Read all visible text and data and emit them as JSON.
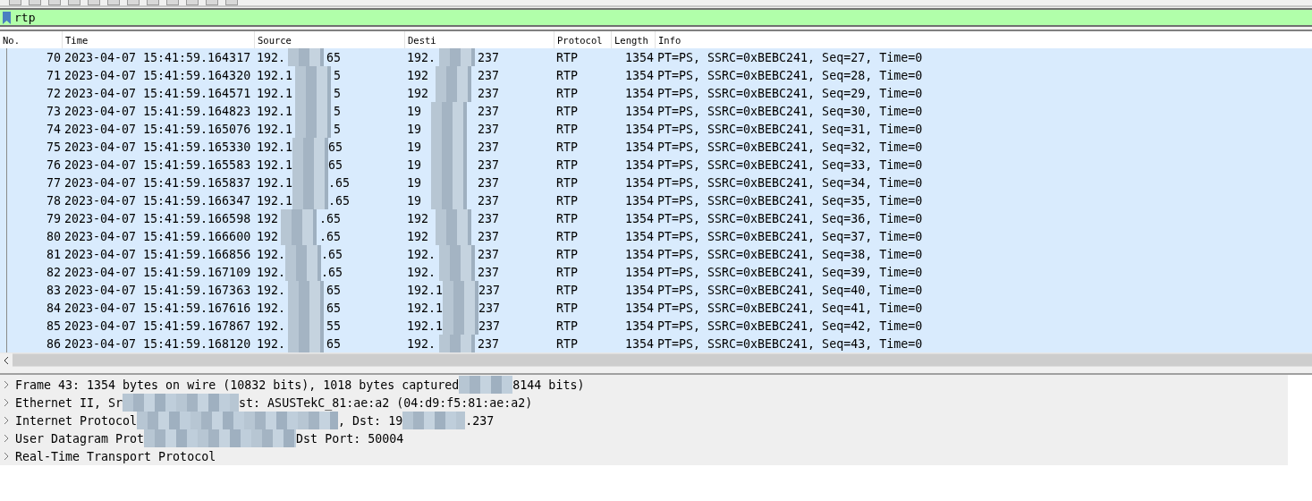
{
  "filter": {
    "value": "rtp"
  },
  "columns": [
    "No.",
    "Time",
    "Source",
    "Desti",
    "Protocol",
    "Length",
    "Info"
  ],
  "rows": [
    {
      "no": "70",
      "time": "2023-04-07 15:41:59.164317",
      "source": [
        "192.",
        "65"
      ],
      "destination": [
        "192.",
        "237"
      ],
      "protocol": "RTP",
      "length": "1354",
      "info": "PT=PS, SSRC=0xBEBC241, Seq=27, Time=0",
      "selected": true
    },
    {
      "no": "71",
      "time": "2023-04-07 15:41:59.164320",
      "source": [
        "192.1",
        "5"
      ],
      "destination": [
        "192",
        "237"
      ],
      "protocol": "RTP",
      "length": "1354",
      "info": "PT=PS, SSRC=0xBEBC241, Seq=28, Time=0",
      "selected": true
    },
    {
      "no": "72",
      "time": "2023-04-07 15:41:59.164571",
      "source": [
        "192.1",
        "5"
      ],
      "destination": [
        "192",
        "237"
      ],
      "protocol": "RTP",
      "length": "1354",
      "info": "PT=PS, SSRC=0xBEBC241, Seq=29, Time=0",
      "selected": true
    },
    {
      "no": "73",
      "time": "2023-04-07 15:41:59.164823",
      "source": [
        "192.1",
        "5"
      ],
      "destination": [
        "19",
        "237"
      ],
      "protocol": "RTP",
      "length": "1354",
      "info": "PT=PS, SSRC=0xBEBC241, Seq=30, Time=0",
      "selected": true
    },
    {
      "no": "74",
      "time": "2023-04-07 15:41:59.165076",
      "source": [
        "192.1",
        "5"
      ],
      "destination": [
        "19",
        "237"
      ],
      "protocol": "RTP",
      "length": "1354",
      "info": "PT=PS, SSRC=0xBEBC241, Seq=31, Time=0",
      "selected": true
    },
    {
      "no": "75",
      "time": "2023-04-07 15:41:59.165330",
      "source": [
        "192.1",
        "65"
      ],
      "destination": [
        "19",
        "237"
      ],
      "protocol": "RTP",
      "length": "1354",
      "info": "PT=PS, SSRC=0xBEBC241, Seq=32, Time=0",
      "selected": true
    },
    {
      "no": "76",
      "time": "2023-04-07 15:41:59.165583",
      "source": [
        "192.1",
        "65"
      ],
      "destination": [
        "19",
        "237"
      ],
      "protocol": "RTP",
      "length": "1354",
      "info": "PT=PS, SSRC=0xBEBC241, Seq=33, Time=0",
      "selected": true
    },
    {
      "no": "77",
      "time": "2023-04-07 15:41:59.165837",
      "source": [
        "192.1",
        ".65"
      ],
      "destination": [
        "19",
        "237"
      ],
      "protocol": "RTP",
      "length": "1354",
      "info": "PT=PS, SSRC=0xBEBC241, Seq=34, Time=0",
      "selected": true
    },
    {
      "no": "78",
      "time": "2023-04-07 15:41:59.166347",
      "source": [
        "192.1",
        ".65"
      ],
      "destination": [
        "19",
        "237"
      ],
      "protocol": "RTP",
      "length": "1354",
      "info": "PT=PS, SSRC=0xBEBC241, Seq=35, Time=0",
      "selected": true
    },
    {
      "no": "79",
      "time": "2023-04-07 15:41:59.166598",
      "source": [
        "192",
        ".65"
      ],
      "destination": [
        "192",
        "237"
      ],
      "protocol": "RTP",
      "length": "1354",
      "info": "PT=PS, SSRC=0xBEBC241, Seq=36, Time=0",
      "selected": true
    },
    {
      "no": "80",
      "time": "2023-04-07 15:41:59.166600",
      "source": [
        "192",
        ".65"
      ],
      "destination": [
        "192",
        "237"
      ],
      "protocol": "RTP",
      "length": "1354",
      "info": "PT=PS, SSRC=0xBEBC241, Seq=37, Time=0",
      "selected": true
    },
    {
      "no": "81",
      "time": "2023-04-07 15:41:59.166856",
      "source": [
        "192.",
        ".65"
      ],
      "destination": [
        "192.",
        "237"
      ],
      "protocol": "RTP",
      "length": "1354",
      "info": "PT=PS, SSRC=0xBEBC241, Seq=38, Time=0",
      "selected": true
    },
    {
      "no": "82",
      "time": "2023-04-07 15:41:59.167109",
      "source": [
        "192.",
        ".65"
      ],
      "destination": [
        "192.",
        "237"
      ],
      "protocol": "RTP",
      "length": "1354",
      "info": "PT=PS, SSRC=0xBEBC241, Seq=39, Time=0",
      "selected": true
    },
    {
      "no": "83",
      "time": "2023-04-07 15:41:59.167363",
      "source": [
        "192.",
        "65"
      ],
      "destination": [
        "192.1",
        "237"
      ],
      "protocol": "RTP",
      "length": "1354",
      "info": "PT=PS, SSRC=0xBEBC241, Seq=40, Time=0",
      "selected": true
    },
    {
      "no": "84",
      "time": "2023-04-07 15:41:59.167616",
      "source": [
        "192.",
        "65"
      ],
      "destination": [
        "192.1",
        "237"
      ],
      "protocol": "RTP",
      "length": "1354",
      "info": "PT=PS, SSRC=0xBEBC241, Seq=41, Time=0",
      "selected": true
    },
    {
      "no": "85",
      "time": "2023-04-07 15:41:59.167867",
      "source": [
        "192.",
        "55"
      ],
      "destination": [
        "192.1",
        "237"
      ],
      "protocol": "RTP",
      "length": "1354",
      "info": "PT=PS, SSRC=0xBEBC241, Seq=42, Time=0",
      "selected": true
    },
    {
      "no": "86",
      "time": "2023-04-07 15:41:59.168120",
      "source": [
        "192.",
        "65"
      ],
      "destination": [
        "192.",
        "237"
      ],
      "protocol": "RTP",
      "length": "1354",
      "info": "PT=PS, SSRC=0xBEBC241, Seq=43, Time=0",
      "selected": true
    }
  ],
  "details": [
    {
      "parts": [
        "Frame 43: 1354 bytes on wire (10832 bits), 1018 bytes captured",
        "8144 bits)"
      ],
      "expanded": false
    },
    {
      "parts": [
        "Ethernet II, Sr",
        "st: ASUSTekC_81:ae:a2 (04:d9:f5:81:ae:a2)"
      ],
      "expanded": false
    },
    {
      "parts": [
        "Internet Protocol",
        ", Dst: 19",
        ".237"
      ],
      "expanded": false
    },
    {
      "parts": [
        "User Datagram Prot",
        "Dst Port: 50004"
      ],
      "expanded": false
    },
    {
      "parts": [
        "Real-Time Transport Protocol"
      ],
      "expanded": false
    }
  ]
}
